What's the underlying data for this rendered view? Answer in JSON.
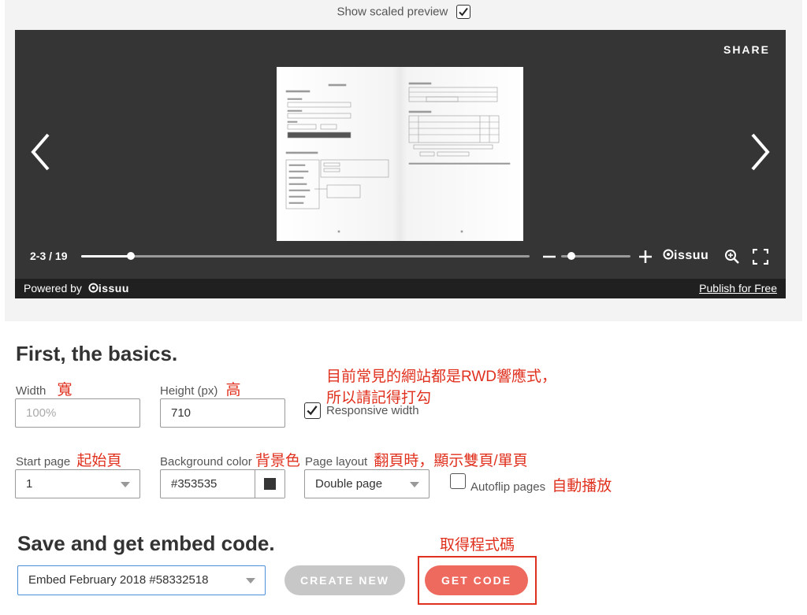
{
  "preview": {
    "show_scaled_label": "Show scaled preview",
    "show_scaled_checked": true
  },
  "viewer": {
    "share_label": "SHARE",
    "page_counter": "2-3 / 19",
    "progress": 0.11,
    "zoom_level": 0.1,
    "brand": "issuu",
    "powered_by": "Powered by",
    "publish_label": "Publish for Free",
    "background_color": "#353535"
  },
  "basics": {
    "heading": "First, the basics.",
    "width_label": "Width",
    "width_annotation": "寬",
    "width_placeholder": "100%",
    "height_label": "Height (px)",
    "height_annotation": "高",
    "height_value": "710",
    "responsive_label": "Responsive width",
    "responsive_checked": true,
    "responsive_annotation_1": "目前常見的網站都是RWD響應式，",
    "responsive_annotation_2": "所以請記得打勾",
    "start_page_label": "Start page",
    "start_page_annotation": "起始頁",
    "start_page_value": "1",
    "bg_color_label": "Background color",
    "bg_color_annotation": "背景色",
    "bg_color_value": "#353535",
    "page_layout_label": "Page layout",
    "page_layout_annotation": "翻頁時，顯示雙頁/單頁",
    "page_layout_value": "Double page",
    "autoflip_label": "Autoflip pages",
    "autoflip_annotation": "自動播放",
    "autoflip_checked": false
  },
  "save": {
    "heading": "Save and get embed code.",
    "embed_select_value": "Embed February 2018 #58332518",
    "create_new_label": "CREATE NEW",
    "get_code_label": "GET CODE",
    "get_code_annotation": "取得程式碼",
    "accent_color": "#ee6a5e"
  }
}
